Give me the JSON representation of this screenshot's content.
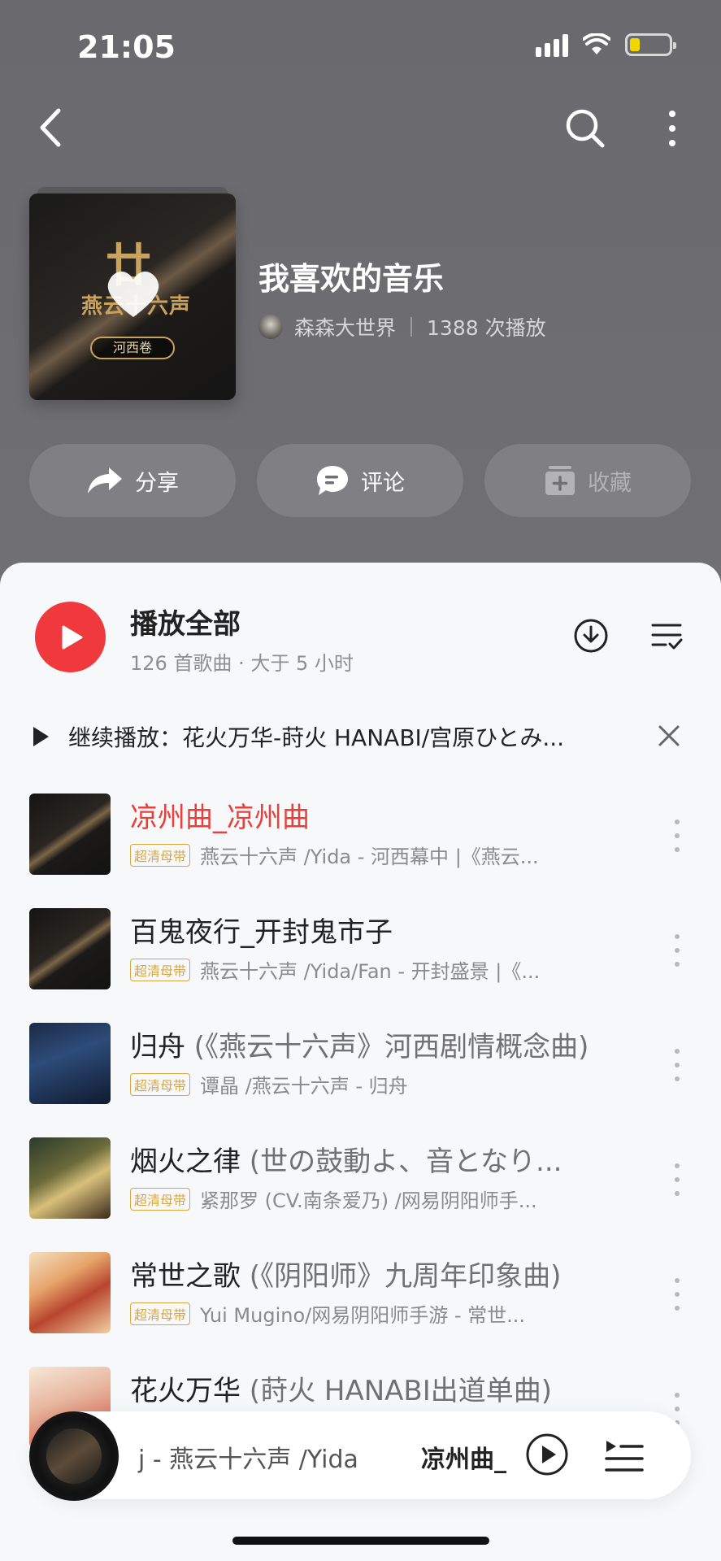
{
  "status": {
    "time": "21:05"
  },
  "nav": {
    "back": "back-icon",
    "search": "search-icon",
    "more": "more-icon"
  },
  "playlist": {
    "title": "我喜欢的音乐",
    "creator": "森森大世界",
    "plays": "1388 次播放",
    "cover": {
      "badge": "河西卷",
      "chars_top": "廿",
      "chars_mid": "燕云十六声"
    }
  },
  "actions": {
    "share": "分享",
    "comment": "评论",
    "collect": "收藏"
  },
  "play_all": {
    "label": "播放全部",
    "sub": "126 首歌曲 · 大于 5 小时"
  },
  "resume": {
    "text": "继续播放：花火万华-莳火 HANABI/宫原ひとみ..."
  },
  "songs": [
    {
      "title": "凉州曲_凉州曲",
      "subtitle": "",
      "tag": "超清母带",
      "artist": "燕云十六声 /Yida - 河西幕中 |《燕云...",
      "active": true
    },
    {
      "title": "百鬼夜行_开封鬼市子",
      "subtitle": "",
      "tag": "超清母带",
      "artist": "燕云十六声 /Yida/Fan - 开封盛景 |《...",
      "active": false
    },
    {
      "title": "归舟",
      "subtitle": " (《燕云十六声》河西剧情概念曲)",
      "tag": "超清母带",
      "artist": "谭晶 /燕云十六声 - 归舟",
      "active": false
    },
    {
      "title": "烟火之律",
      "subtitle": " (世の鼓動よ、音となり...",
      "tag": "超清母带",
      "artist": "紧那罗 (CV.南条爱乃) /网易阴阳师手...",
      "active": false
    },
    {
      "title": "常世之歌",
      "subtitle": " (《阴阳师》九周年印象曲)",
      "tag": "超清母带",
      "artist": "Yui Mugino/网易阴阳师手游 - 常世...",
      "active": false
    },
    {
      "title": "花火万华",
      "subtitle": " (莳火 HANABI出道单曲)",
      "tag": "",
      "artist": "",
      "active": false
    }
  ],
  "mini_player": {
    "scroll_text": "j - 燕云十六声 /Yida",
    "title": "凉州曲_"
  },
  "colors": {
    "accent": "#f0393c",
    "active_song": "#e8413b",
    "tag": "#d8a640"
  }
}
